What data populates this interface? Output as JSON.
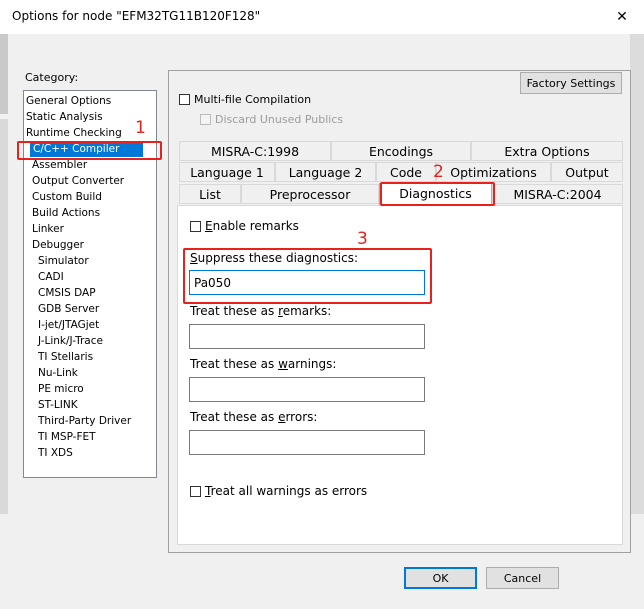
{
  "window": {
    "title": "Options for node \"EFM32TG11B120F128\"",
    "close_glyph": "✕"
  },
  "category": {
    "label": "Category:",
    "items": [
      {
        "label": "General Options",
        "indent": 0
      },
      {
        "label": "Static Analysis",
        "indent": 0
      },
      {
        "label": "Runtime Checking",
        "indent": 0
      },
      {
        "label": "C/C++ Compiler",
        "indent": 1,
        "selected": true
      },
      {
        "label": "Assembler",
        "indent": 1
      },
      {
        "label": "Output Converter",
        "indent": 1
      },
      {
        "label": "Custom Build",
        "indent": 1
      },
      {
        "label": "Build Actions",
        "indent": 1
      },
      {
        "label": "Linker",
        "indent": 1
      },
      {
        "label": "Debugger",
        "indent": 1
      },
      {
        "label": "Simulator",
        "indent": 2
      },
      {
        "label": "CADI",
        "indent": 2
      },
      {
        "label": "CMSIS DAP",
        "indent": 2
      },
      {
        "label": "GDB Server",
        "indent": 2
      },
      {
        "label": "I-jet/JTAGjet",
        "indent": 2
      },
      {
        "label": "J-Link/J-Trace",
        "indent": 2
      },
      {
        "label": "TI Stellaris",
        "indent": 2
      },
      {
        "label": "Nu-Link",
        "indent": 2
      },
      {
        "label": "PE micro",
        "indent": 2
      },
      {
        "label": "ST-LINK",
        "indent": 2
      },
      {
        "label": "Third-Party Driver",
        "indent": 2
      },
      {
        "label": "TI MSP-FET",
        "indent": 2
      },
      {
        "label": "TI XDS",
        "indent": 2
      }
    ]
  },
  "toolbar": {
    "factory_settings": "Factory Settings"
  },
  "options": {
    "multi_file": {
      "label": "Multi-file Compilation",
      "checked": false
    },
    "discard_unused": {
      "label": "Discard Unused Publics",
      "checked": false,
      "enabled": false
    }
  },
  "tabs": {
    "row1": [
      "MISRA-C:1998",
      "Encodings",
      "Extra Options"
    ],
    "row2": [
      "Language 1",
      "Language 2",
      "Code",
      "Optimizations",
      "Output"
    ],
    "row3": [
      "List",
      "Preprocessor",
      "Diagnostics",
      "MISRA-C:2004"
    ],
    "active": "Diagnostics"
  },
  "diagnostics": {
    "enable_remarks": {
      "label_pre": "",
      "label_u": "E",
      "label_post": "nable remarks",
      "checked": false
    },
    "suppress": {
      "label_pre": "",
      "label_u": "S",
      "label_post": "uppress these diagnostics:",
      "value": "Pa050"
    },
    "remarks": {
      "label_pre": "Treat these as ",
      "label_u": "r",
      "label_post": "emarks:",
      "value": ""
    },
    "warnings": {
      "label_pre": "Treat these as ",
      "label_u": "w",
      "label_post": "arnings:",
      "value": ""
    },
    "errors": {
      "label_pre": "Treat these as ",
      "label_u": "e",
      "label_post": "rrors:",
      "value": ""
    },
    "treat_all_warnings": {
      "label_pre": "",
      "label_u": "T",
      "label_post": "reat all warnings as errors",
      "checked": false
    }
  },
  "annotations": [
    "1",
    "2",
    "3"
  ],
  "footer": {
    "ok": "OK",
    "cancel": "Cancel"
  },
  "colors": {
    "accent": "#0078d7",
    "annotation": "#e8211d",
    "background": "#f0f0f0"
  }
}
